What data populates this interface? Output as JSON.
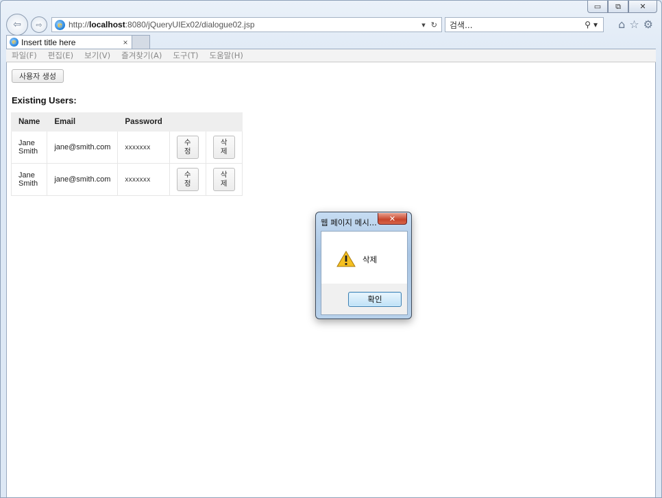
{
  "browser": {
    "address": {
      "url_prefix": "http://",
      "url_host": "localhost",
      "url_rest": ":8080/jQueryUIEx02/dialogue02.jsp",
      "dropdown_icon": "chevron-down-icon",
      "refresh_icon": "refresh-icon"
    },
    "search": {
      "placeholder": "검색..."
    },
    "tab": {
      "title": "Insert title here",
      "close": "×"
    },
    "menu": [
      "파일(F)",
      "편집(E)",
      "보기(V)",
      "즐겨찾기(A)",
      "도구(T)",
      "도움말(H)"
    ]
  },
  "page": {
    "create_button": "사용자 생성",
    "heading": "Existing Users:",
    "table": {
      "headers": [
        "Name",
        "Email",
        "Password",
        "",
        ""
      ],
      "rows": [
        {
          "name_line1": "Jane",
          "name_line2": "Smith",
          "email": "jane@smith.com",
          "password": "xxxxxxx",
          "edit_1": "수",
          "edit_2": "정",
          "delete_1": "삭",
          "delete_2": "제"
        },
        {
          "name_line1": "Jane",
          "name_line2": "Smith",
          "email": "jane@smith.com",
          "password": "xxxxxxx",
          "edit_1": "수",
          "edit_2": "정",
          "delete_1": "삭",
          "delete_2": "제"
        }
      ]
    }
  },
  "dialog": {
    "title": "웹 페이지 메시...",
    "close": "✕",
    "message": "삭제",
    "ok_button": "확인",
    "icon": "warning-icon"
  },
  "colors": {
    "dialog_close": "#c7452c",
    "ok_border": "#3c7fb1",
    "warning": "#f5c020"
  }
}
